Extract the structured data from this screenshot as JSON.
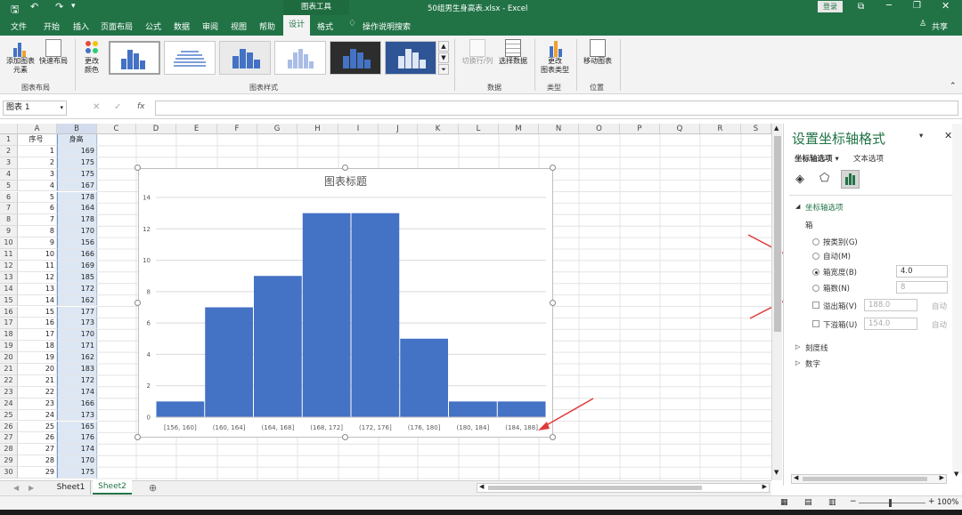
{
  "titlebar": {
    "file_title": "50组男生身高表.xlsx - Excel",
    "tool_context": "图表工具",
    "login": "登录"
  },
  "tabs": [
    "文件",
    "开始",
    "插入",
    "页面布局",
    "公式",
    "数据",
    "审阅",
    "视图",
    "帮助",
    "设计",
    "格式"
  ],
  "tell_me": "操作说明搜索",
  "share": "共享",
  "ribbon": {
    "add_element": "添加图表\n元素",
    "quick_layout": "快速布局",
    "change_colors": "更改\n颜色",
    "group_layout": "图表布局",
    "group_styles": "图表样式",
    "switch_rowcol": "切换行/列",
    "select_data": "选择数据",
    "group_data": "数据",
    "change_type": "更改\n图表类型",
    "group_type": "类型",
    "move_chart": "移动图表",
    "group_location": "位置"
  },
  "formula_bar": {
    "name_box": "图表 1",
    "fx": "fx",
    "value": ""
  },
  "columns": [
    "A",
    "B",
    "C",
    "D",
    "E",
    "F",
    "G",
    "H",
    "I",
    "J",
    "K",
    "L",
    "M",
    "N",
    "O",
    "P",
    "Q",
    "R",
    "S"
  ],
  "header_row": {
    "a": "序号",
    "b": "身高"
  },
  "heights": [
    169,
    175,
    175,
    167,
    178,
    164,
    178,
    170,
    156,
    166,
    169,
    185,
    172,
    162,
    177,
    173,
    170,
    171,
    162,
    183,
    172,
    174,
    166,
    173,
    165,
    176,
    174,
    170,
    175
  ],
  "chart": {
    "title": "图表标题",
    "chart_data": {
      "type": "bar",
      "categories": [
        "[156, 160]",
        "(160, 164]",
        "(164, 168]",
        "(168, 172]",
        "(172, 176]",
        "(176, 180]",
        "(180, 184]",
        "(184, 188]"
      ],
      "values": [
        1,
        7,
        9,
        13,
        13,
        5,
        1,
        1
      ],
      "ylim": [
        0,
        14
      ],
      "yticks": [
        "0",
        "2",
        "4",
        "6",
        "8",
        "10",
        "12",
        "14"
      ],
      "color": "#4472c4",
      "title": "图表标题"
    }
  },
  "pane": {
    "title": "设置坐标轴格式",
    "subtab1": "坐标轴选项",
    "subtab2": "文本选项",
    "section": "坐标轴选项",
    "bins_label": "箱",
    "by_category": "按类别(G)",
    "auto": "自动(M)",
    "bin_width": "箱宽度(B)",
    "bin_width_value": "4.0",
    "bin_count": "箱数(N)",
    "bin_count_value": "8",
    "overflow": "溢出箱(V)",
    "overflow_value": "188.0",
    "underflow": "下溢箱(U)",
    "underflow_value": "154.0",
    "auto_short": "自动",
    "tick_marks": "刻度线",
    "number": "数字"
  },
  "sheets": [
    "Sheet1",
    "Sheet2"
  ],
  "status": {
    "zoom": "100%"
  }
}
